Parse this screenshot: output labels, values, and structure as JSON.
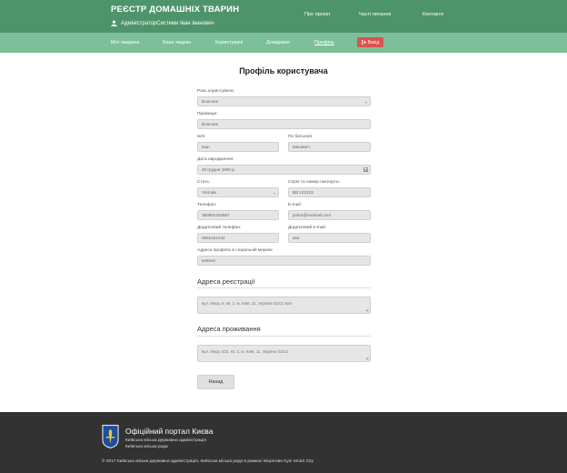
{
  "header": {
    "site_title": "РЕЄСТР ДОМАШНІХ ТВАРИН",
    "user_name": "АдміністраторСистеми Іван Іванович",
    "links": [
      "Про проект",
      "Часті питання",
      "Контакти"
    ]
  },
  "nav": {
    "items": [
      "Мої тварини",
      "База тварин",
      "Користувачі",
      "Довідники",
      "Профіль"
    ],
    "active": "Профіль",
    "exit_label": "Вихід"
  },
  "profile": {
    "title": "Профіль користувача",
    "role": {
      "label": "Роль користувача:",
      "value": "Власник"
    },
    "surname": {
      "label": "Прізвище:",
      "value": "Власник"
    },
    "first_name": {
      "label": "Ім'я:",
      "value": "Іван"
    },
    "patronymic": {
      "label": "По батькові:",
      "value": "Іванович"
    },
    "birth_date": {
      "label": "Дата народження:",
      "value": "20 грудня 1990 р."
    },
    "gender": {
      "label": "Стать:",
      "value": "Чоловік"
    },
    "passport": {
      "label": "Серія та номер паспорта:",
      "value": "ВВ 123123"
    },
    "phone": {
      "label": "Телефон:",
      "value": "380991234567"
    },
    "email": {
      "label": "E-mail:",
      "value": "yorior@mutmail.com"
    },
    "extra_phone": {
      "label": "Додатковий телефон:",
      "value": "0991231232"
    },
    "extra_email": {
      "label": "Додатковий e-mail:",
      "value": "asa"
    },
    "social": {
      "label": "Адреса профілю в соціальній мережі:",
      "value": "testtest"
    }
  },
  "registration_address": {
    "heading": "Адреса реєстрації",
    "value": "вул. Миру, 5, кв. 2, м. Київ, 11, Україна 01011 вал"
  },
  "residence_address": {
    "heading": "Адреса проживання",
    "value": "вул. Миру, 523, кв. 2, м. Київ, 11, Україна 01011"
  },
  "back_label": "Назад",
  "footer": {
    "title": "Офіційний портал Києва",
    "line1": "Київська міська державна адміністрація",
    "line2": "Київська міська рада",
    "copyright": "© 2017 Київська міська державна адміністрація, Київська міська рада в рамках ініціативи Kyiv Smart City"
  },
  "colors": {
    "header_bg": "#4e946a",
    "nav_bg": "#7dbf98",
    "exit_bg": "#d9534f",
    "footer_bg": "#323232"
  }
}
